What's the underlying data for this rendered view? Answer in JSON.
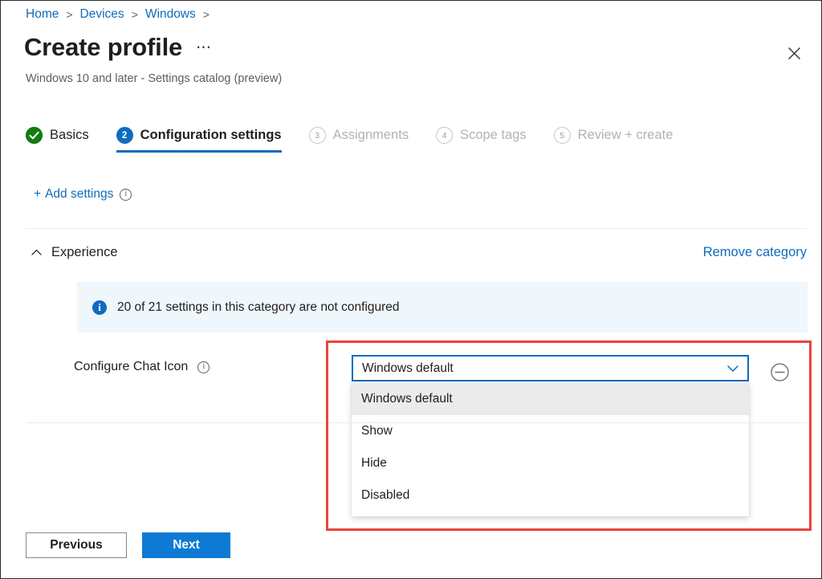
{
  "breadcrumb": {
    "items": [
      "Home",
      "Devices",
      "Windows"
    ],
    "separator": ">",
    "trailing_separator": ">"
  },
  "header": {
    "title": "Create profile",
    "ellipsis": "⋯",
    "subtitle": "Windows 10 and later - Settings catalog (preview)",
    "close_icon": "close-icon"
  },
  "steps": [
    {
      "number": "✓",
      "label": "Basics",
      "state": "done"
    },
    {
      "number": "2",
      "label": "Configuration settings",
      "state": "active"
    },
    {
      "number": "3",
      "label": "Assignments",
      "state": "todo"
    },
    {
      "number": "4",
      "label": "Scope tags",
      "state": "todo"
    },
    {
      "number": "5",
      "label": "Review + create",
      "state": "todo"
    }
  ],
  "add_settings": {
    "plus": "+",
    "label": "Add settings",
    "info_glyph": "i"
  },
  "category": {
    "name": "Experience",
    "remove_label": "Remove category",
    "collapse_icon": "chevron-up-icon"
  },
  "info_banner": {
    "glyph": "i",
    "text": "20 of 21 settings in this category are not configured"
  },
  "setting": {
    "label": "Configure Chat Icon",
    "info_glyph": "i",
    "selected_value": "Windows default",
    "options": [
      "Windows default",
      "Show",
      "Hide",
      "Disabled"
    ],
    "remove_setting_icon": "minus-circle-icon"
  },
  "footer": {
    "previous_label": "Previous",
    "next_label": "Next"
  },
  "colors": {
    "accent": "#0f6cbd",
    "primary_button": "#0f7ad4",
    "success": "#107c10",
    "banner_bg": "#eff6fc",
    "annotation": "#e8453c"
  }
}
